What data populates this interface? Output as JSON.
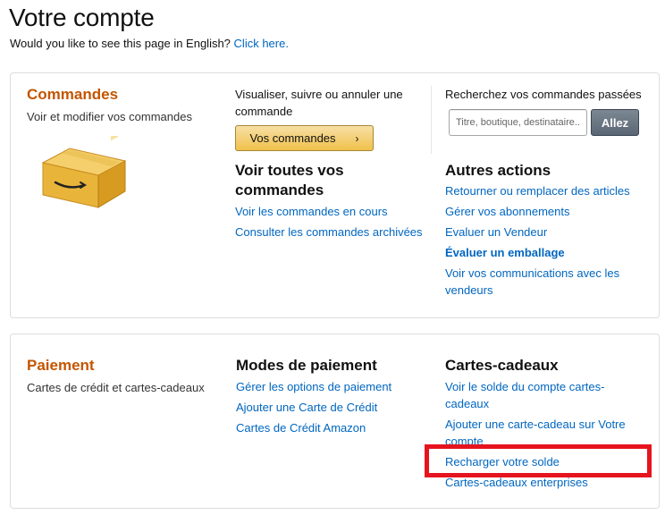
{
  "page": {
    "title": "Votre compte",
    "lang_prompt": "Would you like to see this page in English?",
    "lang_link": "Click here."
  },
  "orders": {
    "title": "Commandes",
    "description": "Voir et modifier vos commandes",
    "manage_text_line1": "Visualiser, suivre ou annuler une",
    "manage_text_line2": "commande",
    "button_label": "Vos commandes",
    "button_chevron": "›",
    "search_label": "Recherchez vos commandes passées",
    "search_placeholder": "Titre, boutique, destinataire...",
    "search_button": "Allez",
    "all_orders_title_line1": "Voir toutes vos",
    "all_orders_title_line2": "commandes",
    "all_orders_links": [
      "Voir les commandes en cours",
      "Consulter les commandes archivées"
    ],
    "other_actions_title": "Autres actions",
    "other_actions_links": [
      "Retourner ou remplacer des articles",
      "Gérer vos abonnements",
      "Evaluer un Vendeur",
      "Évaluer un emballage",
      "Voir vos communications avec les vendeurs"
    ]
  },
  "payment": {
    "title": "Paiement",
    "description": "Cartes de crédit et cartes-cadeaux",
    "methods_title": "Modes de paiement",
    "methods_links": [
      "Gérer les options de paiement",
      "Ajouter une Carte de Crédit",
      "Cartes de Crédit Amazon"
    ],
    "giftcards_title": "Cartes-cadeaux",
    "giftcards_links": [
      "Voir le solde du compte cartes-cadeaux",
      "Ajouter une carte-cadeau sur Votre compte",
      "Recharger votre solde",
      "Cartes-cadeaux enterprises"
    ]
  },
  "icons": {
    "box": "amazon-box-icon",
    "chevron": "chevron-right-icon"
  },
  "colors": {
    "section_title": "#c45500",
    "link": "#0066c0",
    "highlight": "#e5141e",
    "button_primary": "#f0c14b"
  }
}
